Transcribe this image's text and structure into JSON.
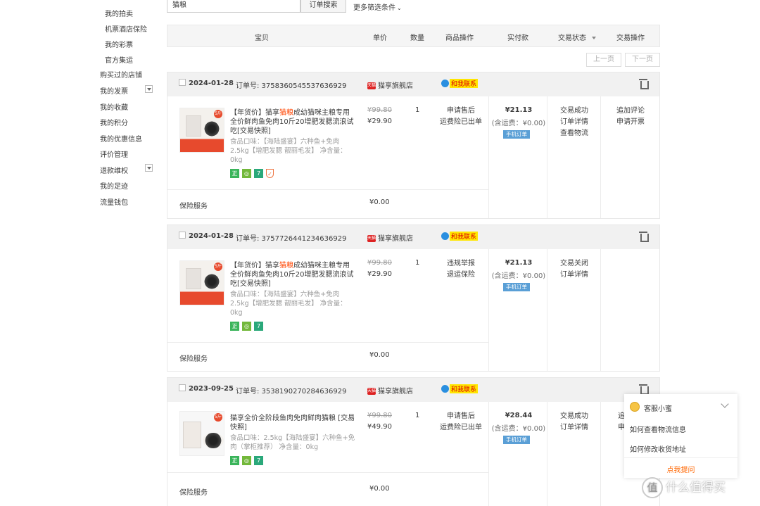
{
  "sidebar": {
    "items": [
      {
        "label": "我的拍卖"
      },
      {
        "label": "机票酒店保险"
      },
      {
        "label": "我的彩票"
      },
      {
        "label": "官方集运"
      },
      {
        "label": "购买过的店铺"
      },
      {
        "label": "我的发票"
      },
      {
        "label": "我的收藏"
      },
      {
        "label": "我的积分"
      },
      {
        "label": "我的优惠信息"
      },
      {
        "label": "评价管理"
      },
      {
        "label": "退款维权"
      },
      {
        "label": "我的足迹"
      },
      {
        "label": "流量钱包"
      }
    ]
  },
  "search": {
    "value": "猫粮",
    "button": "订单搜索",
    "more": "更多筛选条件"
  },
  "table_header": {
    "product": "宝贝",
    "unit_price": "单价",
    "qty": "数量",
    "product_ops": "商品操作",
    "paid": "实付款",
    "status": "交易状态",
    "actions": "交易操作"
  },
  "pager": {
    "prev": "上一页",
    "next": "下一页"
  },
  "orders": [
    {
      "date": "2024-01-28",
      "order_no": "订单号: 3758360545537636929",
      "shop": "猫享旗舰店",
      "contact": "和我联系",
      "title_pre": "【年货价】猫享",
      "title_hl": "猫粮",
      "title_post": "成幼猫咪主粮专用全价鲜肉鱼免肉10斤20增肥发腮流浪试吃[交易快照]",
      "spec": "食品口味：【海陆盛宴】六种鱼+免肉2.5kg【增肥发腮 靓丽毛发】 净含量：0kg",
      "orig_price": "¥99.80",
      "price": "¥29.90",
      "qty": "1",
      "product_actions": [
        "申请售后",
        "运费险已出单"
      ],
      "total": "¥21.13",
      "shipping": "(含运费：¥0.00)",
      "mobile": "手机订单",
      "status": [
        "交易成功",
        "订单详情",
        "查看物流"
      ],
      "ops": [
        "追加评论",
        "申请开票"
      ],
      "insurance_label": "保险服务",
      "insurance_value": "¥0.00"
    },
    {
      "date": "2024-01-28",
      "order_no": "订单号: 3757726441234636929",
      "shop": "猫享旗舰店",
      "contact": "和我联系",
      "title_pre": "【年货价】猫享",
      "title_hl": "猫粮",
      "title_post": "成幼猫咪主粮专用全价鲜肉鱼免肉10斤20增肥发腮流浪试吃[交易快照]",
      "spec": "食品口味：【海陆盛宴】六种鱼+免肉2.5kg【增肥发腮 靓丽毛发】 净含量：0kg",
      "orig_price": "¥99.80",
      "price": "¥29.90",
      "qty": "1",
      "product_actions": [
        "违规举报",
        "退运保险"
      ],
      "total": "¥21.13",
      "shipping": "(含运费：¥0.00)",
      "mobile": "手机订单",
      "status": [
        "交易关闭",
        "订单详情"
      ],
      "ops": [],
      "insurance_label": "保险服务",
      "insurance_value": "¥0.00"
    },
    {
      "date": "2023-09-25",
      "order_no": "订单号: 3538190270284636929",
      "shop": "猫享旗舰店",
      "contact": "和我联系",
      "title_pre": "猫享全价全阶段鱼肉免肉鲜肉猫粮 [交易快照]",
      "title_hl": "",
      "title_post": "",
      "spec": "食品口味：2.5kg【海陆盛宴】六种鱼+免肉（掌柜推荐） 净含量：0kg",
      "orig_price": "¥99.80",
      "price": "¥49.90",
      "qty": "1",
      "product_actions": [
        "申请售后",
        "运费险已出单"
      ],
      "total": "¥28.44",
      "shipping": "(含运费：¥0.00)",
      "mobile": "手机订单",
      "status": [
        "交易成功",
        "订单详情"
      ],
      "ops": [
        "追",
        "申"
      ],
      "insurance_label": "保险服务",
      "insurance_value": "¥0.00"
    }
  ],
  "chat": {
    "title": "客服小蜜",
    "q1": "如何查看物流信息",
    "q2": "如何修改收货地址",
    "ask": "点我提问"
  },
  "watermark": {
    "logo": "值",
    "text": "什么值得买"
  }
}
